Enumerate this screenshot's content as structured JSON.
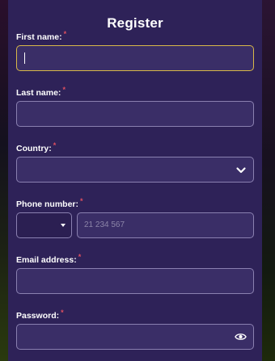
{
  "form": {
    "title": "Register",
    "first_name": {
      "label": "First name:",
      "required_mark": "*",
      "value": ""
    },
    "last_name": {
      "label": "Last name:",
      "required_mark": "*",
      "value": ""
    },
    "country": {
      "label": "Country:",
      "required_mark": "*",
      "selected": "",
      "icon": "chevron-down-icon"
    },
    "phone": {
      "label": "Phone number:",
      "required_mark": "*",
      "code_selected": "",
      "placeholder": "21 234 567",
      "icon": "caret-down-icon"
    },
    "email": {
      "label": "Email address:",
      "required_mark": "*",
      "value": ""
    },
    "password": {
      "label": "Password:",
      "required_mark": "*",
      "value": "",
      "icon": "eye-icon"
    }
  },
  "colors": {
    "panel": "#2e2258",
    "field": "#3a2e67",
    "focus_border": "#d8b848",
    "required": "#e05060"
  }
}
